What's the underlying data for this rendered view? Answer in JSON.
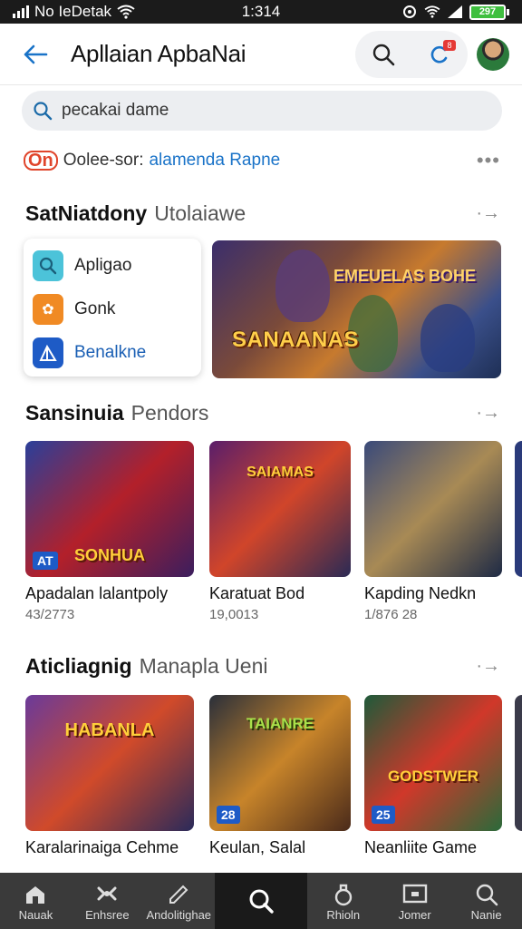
{
  "status": {
    "carrier": "No IeDetak",
    "time": "1:314",
    "battery": "297"
  },
  "appbar": {
    "title": "Apllaian ApbaNai",
    "badge": "8"
  },
  "search": {
    "placeholder": "pecakai dame"
  },
  "suggest": {
    "logo": "On",
    "prefix": "Oolee-sor:",
    "link": "alamenda Rapne"
  },
  "section1": {
    "bold": "SatNiatdony",
    "light": "Utolaiawe"
  },
  "menu": [
    {
      "label": "Apligao",
      "icon": "search-icon",
      "color": "#4cc3d9"
    },
    {
      "label": "Gonk",
      "icon": "puzzle-icon",
      "color": "#f08a24"
    },
    {
      "label": "Benalkne",
      "icon": "mountain-icon",
      "color": "#1e5bc6"
    }
  ],
  "banner": {
    "title": "SANAANAS",
    "subtitle": "EMEUELAS BOHE"
  },
  "section2": {
    "bold": "Sansinuia",
    "light": "Pendors"
  },
  "row1": [
    {
      "name": "Apadalan lalantpoly",
      "meta": "43/2773",
      "tag": "AT",
      "overlay": "SONHUA",
      "colors": [
        "#2a3f9a",
        "#b3202a",
        "#3b1e5e"
      ]
    },
    {
      "name": "Karatuat Bod",
      "meta": "19,0013",
      "tag": "",
      "overlay": "SAIAMAS",
      "colors": [
        "#5a1e6a",
        "#d0452a",
        "#2a2a55"
      ]
    },
    {
      "name": "Kapding Nedkn",
      "meta": "1/876 28",
      "tag": "",
      "overlay": "",
      "colors": [
        "#3a4a7a",
        "#a88a55",
        "#1e2a45"
      ]
    }
  ],
  "section3": {
    "bold": "Aticliagnig",
    "light": "Manapla Ueni"
  },
  "row2": [
    {
      "name": "Karalarinaiga Cehme",
      "meta": "",
      "tag": "",
      "overlay": "HABANLA",
      "colors": [
        "#6a3a9a",
        "#d04a2a",
        "#2a2a5a"
      ]
    },
    {
      "name": "Keulan, Salal",
      "meta": "",
      "tag": "28",
      "overlay": "TAIANRE",
      "colors": [
        "#2a2f3a",
        "#c7842a",
        "#4a2a1a"
      ]
    },
    {
      "name": "Neanliite Game",
      "meta": "",
      "tag": "25",
      "overlay": "GODSTWER",
      "colors": [
        "#1e5a3a",
        "#d0382a",
        "#2a6a3a"
      ]
    }
  ],
  "nav": [
    {
      "label": "Nauak",
      "icon": "home-icon"
    },
    {
      "label": "Enhsree",
      "icon": "gamepad-icon"
    },
    {
      "label": "Andolitighae",
      "icon": "pen-icon"
    },
    {
      "label": "",
      "icon": "search-icon",
      "active": true
    },
    {
      "label": "Rhioln",
      "icon": "bag-icon"
    },
    {
      "label": "Jomer",
      "icon": "screen-icon"
    },
    {
      "label": "Nanie",
      "icon": "profile-icon"
    }
  ]
}
